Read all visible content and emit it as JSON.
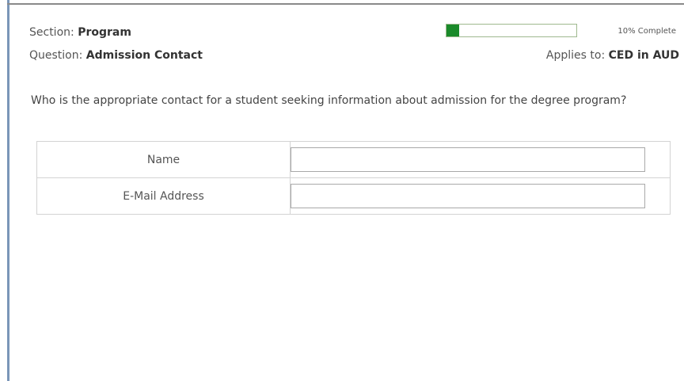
{
  "header": {
    "section_label": "Section:",
    "section_value": "Program",
    "question_label": "Question:",
    "question_value": "Admission Contact",
    "applies_label": "Applies to:",
    "applies_value": "CED in AUD"
  },
  "progress": {
    "percent": 10,
    "text": "10% Complete",
    "fill_color": "#1a8a2a"
  },
  "question": {
    "prompt": "Who is the appropriate contact for a student seeking information about admission for the degree program?"
  },
  "form": {
    "rows": [
      {
        "label": "Name",
        "value": "",
        "placeholder": ""
      },
      {
        "label": "E-Mail Address",
        "value": "",
        "placeholder": ""
      }
    ]
  }
}
